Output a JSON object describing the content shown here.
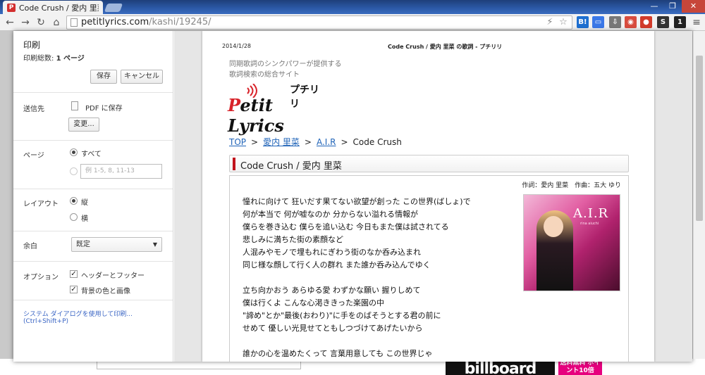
{
  "browser": {
    "tab_title": "Code Crush / 愛内 里菜 ×",
    "tab_favicon": "P",
    "tab_close": "×",
    "url_host": "petitlyrics.com",
    "url_path": "/kashi/19245/",
    "window_controls": {
      "minimize": "—",
      "maximize": "❐",
      "close": "✕"
    },
    "extensions": [
      {
        "name": "hatena-bookmark-icon",
        "label": "B!",
        "color": "#1e6fd0"
      },
      {
        "name": "chat-icon",
        "label": "▭",
        "color": "#3b78e7"
      },
      {
        "name": "download-icon",
        "label": "⇩",
        "color": "#777777"
      },
      {
        "name": "adblock-icon",
        "label": "◉",
        "color": "#d84c3e"
      },
      {
        "name": "record-icon",
        "label": "●",
        "color": "#d23b2a"
      },
      {
        "name": "evernote-icon",
        "label": "S",
        "color": "#333333"
      },
      {
        "name": "notification-icon",
        "label": "1",
        "color": "#222222"
      }
    ]
  },
  "print_panel": {
    "title": "印刷",
    "summary_label": "印刷総数:",
    "summary_value": "1 ページ",
    "print_button": "保存",
    "cancel_button": "キャンセル",
    "destination_label": "送信先",
    "destination_value": "PDF に保存",
    "change_button": "変更...",
    "pages_label": "ページ",
    "pages_all": "すべて",
    "pages_placeholder": "例 1-5, 8, 11-13",
    "layout_label": "レイアウト",
    "layout_portrait": "縦",
    "layout_landscape": "横",
    "margins_label": "余白",
    "margins_value": "既定",
    "options_label": "オプション",
    "option_header_footer": "ヘッダーとフッター",
    "option_background": "背景の色と画像",
    "system_dialog_link": "システム ダイアログを使用して印刷... (Ctrl+Shift+P)"
  },
  "preview": {
    "header_date": "2014/1/28",
    "header_title": "Code Crush / 愛内 里菜 の歌詞 - プチリリ",
    "tagline_1": "同期歌詞のシンクパワーが提供する",
    "tagline_2": "歌詞検索の総合サイト",
    "logo_kana": "プチリリ",
    "logo_p": "P",
    "logo_rest": "etit Lyrics",
    "breadcrumb": [
      {
        "text": "TOP",
        "link": true
      },
      {
        "text": "愛内 里菜",
        "link": true
      },
      {
        "text": "A.I.R",
        "link": true
      },
      {
        "text": "Code Crush",
        "link": false
      }
    ],
    "breadcrumb_sep": ">",
    "song_heading": "Code Crush / 愛内 里菜",
    "credits": "作詞：愛内 里菜　作曲：五大 ゆり",
    "cover_title": "A.I.R",
    "cover_subtitle": "rina aiuchi",
    "lyrics": "憧れに向けて 狂いだす果てない欲望が創った この世界(ばしょ)で\n何が本当で 何が嘘なのか 分からない溢れる情報が\n僕らを巻き込む 僕らを追い込む 今日もまた僕は試されてる\n悲しみに満ちた街の素顔など\n人混みやモノで埋もれにぎわう街のなか呑み込まれ\n同じ様な顔して行く人の群れ また誰か呑み込んでゆく\n\n立ち向かおう あらゆる愛 わずかな願い 握りしめて\n僕は行くよ こんな心渇ききった楽園の中\n\"諦め\"とか\"最後(おわり)\"に手をのばそうとする君の前に\nせめて 優しい光見せてともしつづけてあげたいから\n\n誰かの心を温めたくって 言葉用意しても この世界じゃ"
  },
  "background_page": {
    "banner_text": "billboard",
    "promo_text": "送料無料 ポイント10倍"
  }
}
